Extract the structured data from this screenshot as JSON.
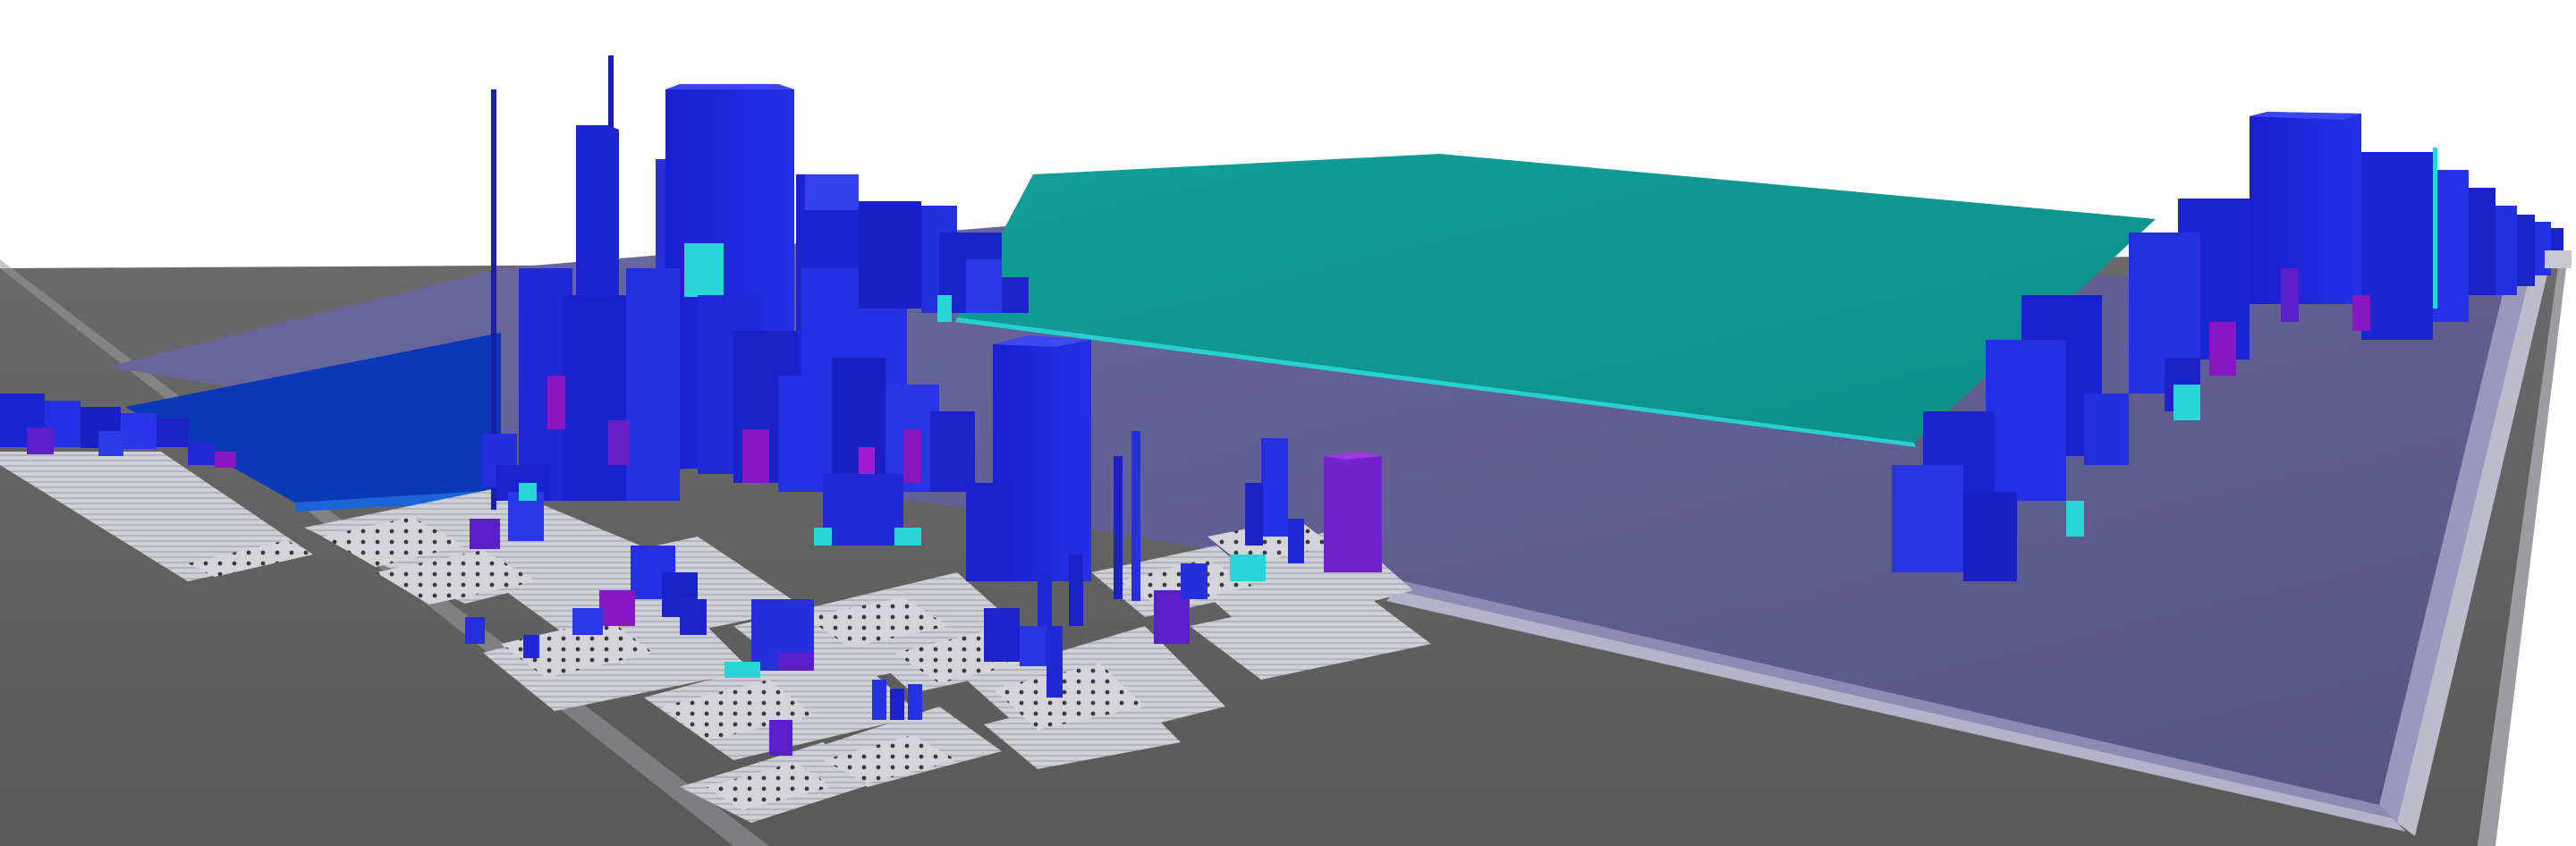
{
  "scene": {
    "kind": "3d-code-city-visualization",
    "colors": {
      "background": "#ffffff",
      "ground": "#616161",
      "ground_edge": "#8c8c8c",
      "plateau": "#5f5c8e",
      "plateau_light": "#7a78a6",
      "step": "#c9c8cf",
      "teal_slab": "#0e9b94",
      "teal_top": "#13aea6",
      "blue_slab": "#0838b8",
      "building": "#1a23d6",
      "building_dark": "#0f15a6",
      "building_light": "#3a47ef",
      "building_violet": "#5a1fc9",
      "building_magenta": "#8a16c0",
      "building_cyan": "#28d6d8"
    }
  }
}
